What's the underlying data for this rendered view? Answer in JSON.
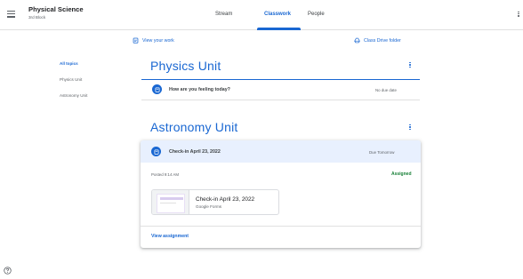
{
  "header": {
    "class_title": "Physical Science",
    "class_subtitle": "3rd Block",
    "tabs": [
      {
        "label": "Stream"
      },
      {
        "label": "Classwork"
      },
      {
        "label": "People"
      }
    ]
  },
  "actions": {
    "view_work": "View your work",
    "drive_folder": "Class Drive folder"
  },
  "sidebar": {
    "items": [
      {
        "label": "All topics"
      },
      {
        "label": "Physics Unit"
      },
      {
        "label": "Astronomy Unit"
      }
    ]
  },
  "topics": [
    {
      "title": "Physics Unit",
      "items": [
        {
          "title": "How are you feeling today?",
          "due": "No due date"
        }
      ]
    },
    {
      "title": "Astronomy Unit",
      "items": [
        {
          "title": "Check-in April 23, 2022",
          "due": "Due Tomorrow",
          "posted": "Posted 9:14 AM",
          "status": "Assigned",
          "attachment": {
            "title": "Check-in April 23, 2022",
            "type": "Google Forms"
          },
          "view_label": "View assignment"
        }
      ]
    }
  ],
  "colors": {
    "accent": "#1967d2",
    "assigned": "#188038",
    "highlight": "#e8f0fe"
  }
}
